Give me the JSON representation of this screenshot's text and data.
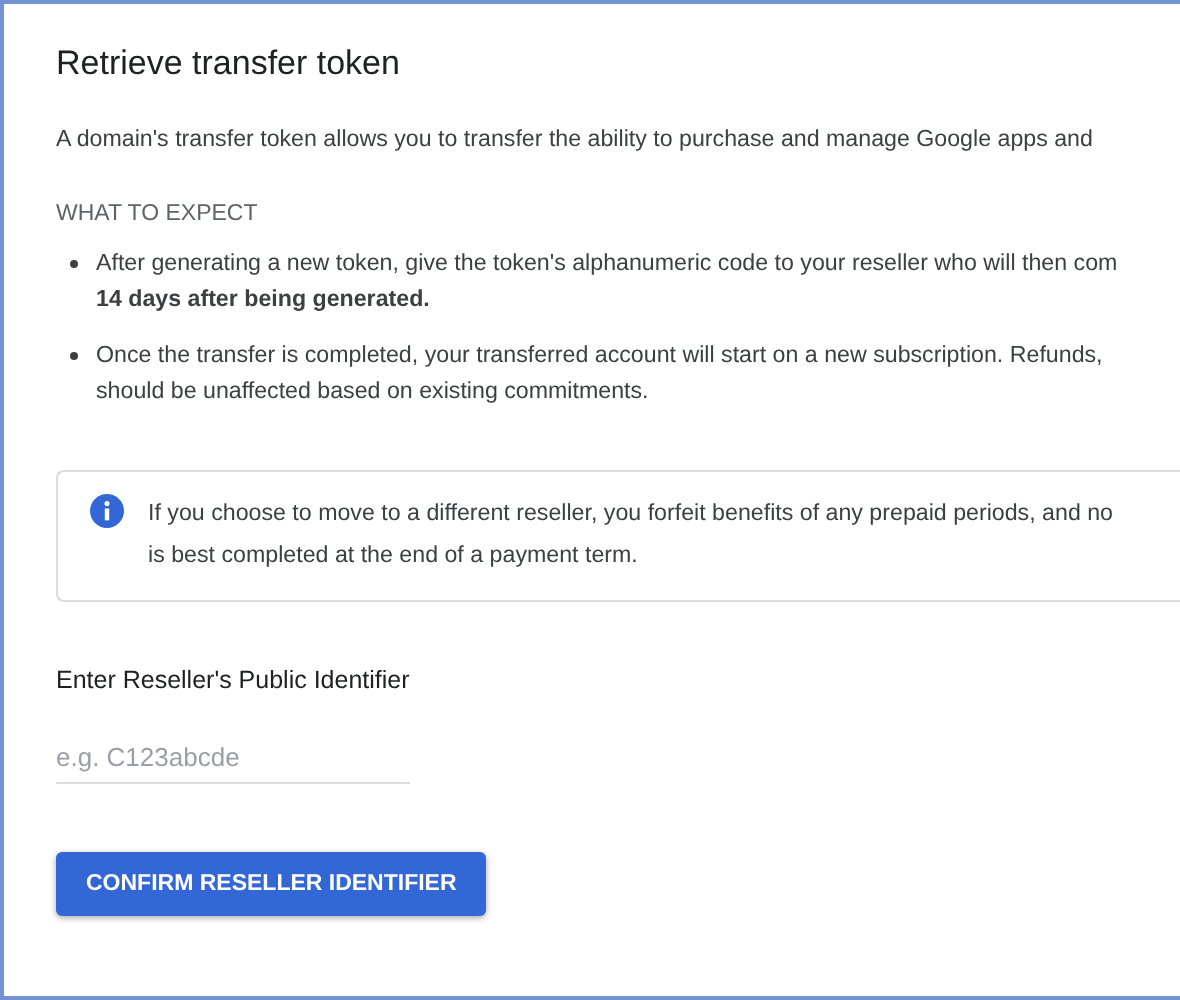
{
  "title": "Retrieve transfer token",
  "intro": "A domain's transfer token allows you to transfer the ability to purchase and manage Google apps and",
  "section_heading": "WHAT TO EXPECT",
  "bullets": [
    {
      "lines": [
        "After generating a new token, give the token's alphanumeric code to your reseller who will then com",
        "**14 days after being generated.**"
      ]
    },
    {
      "lines": [
        "Once the transfer is completed, your transferred account will start on a new subscription. Refunds,",
        "should be unaffected based on existing commitments."
      ]
    }
  ],
  "notice": {
    "lines": [
      "If you choose to move to a different reseller, you forfeit benefits of any prepaid periods, and no",
      "is best completed at the end of a payment term."
    ]
  },
  "identifier_label": "Enter Reseller's Public Identifier",
  "identifier_field": {
    "placeholder": "e.g. C123abcde"
  },
  "confirm_button": "CONFIRM RESELLER IDENTIFIER"
}
